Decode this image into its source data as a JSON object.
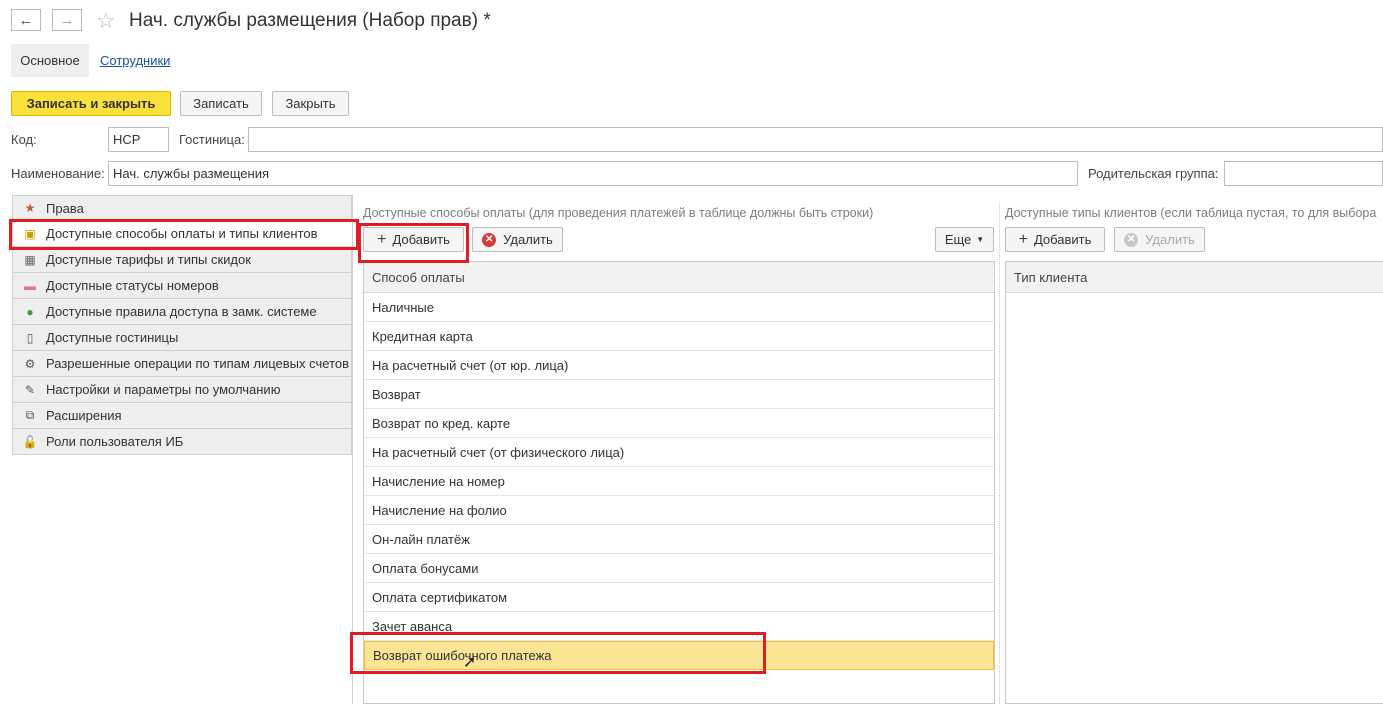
{
  "window": {
    "title": "Нач. службы размещения (Набор прав) *",
    "back_icon": "←",
    "forward_icon": "→",
    "star_icon": "☆"
  },
  "tabs": [
    {
      "label": "Основное"
    },
    {
      "label": "Сотрудники"
    }
  ],
  "toolbar": {
    "save_close": "Записать и закрыть",
    "save": "Записать",
    "close": "Закрыть"
  },
  "form": {
    "code_label": "Код:",
    "code_value": "НСР",
    "hotel_label": "Гостиница:",
    "hotel_value": "",
    "name_label": "Наименование:",
    "name_value": "Нач. службы размещения",
    "parent_label": "Родительская группа:",
    "parent_value": ""
  },
  "sidebar": {
    "items": [
      {
        "label": "Права",
        "icon": "★"
      },
      {
        "label": "Доступные способы оплаты и типы клиентов",
        "icon": "▣"
      },
      {
        "label": "Доступные тарифы и типы скидок",
        "icon": "▦"
      },
      {
        "label": "Доступные статусы номеров",
        "icon": "▬"
      },
      {
        "label": "Доступные правила доступа в замк. системе",
        "icon": "●"
      },
      {
        "label": "Доступные гостиницы",
        "icon": "▯"
      },
      {
        "label": "Разрешенные операции по типам лицевых счетов",
        "icon": "⚙"
      },
      {
        "label": "Настройки и параметры по умолчанию",
        "icon": "✎"
      },
      {
        "label": "Расширения",
        "icon": "⧉"
      },
      {
        "label": "Роли пользователя ИБ",
        "icon": "🔓"
      }
    ]
  },
  "payment_panel": {
    "caption": "Доступные способы оплаты (для проведения платежей в таблице должны быть строки)",
    "add_label": "Добавить",
    "delete_label": "Удалить",
    "more_label": "Еще",
    "column_header": "Способ оплаты",
    "rows": [
      "Наличные",
      "Кредитная карта",
      "На расчетный счет (от юр. лица)",
      "Возврат",
      "Возврат по кред. карте",
      "На расчетный счет (от физического лица)",
      "Начисление на номер",
      "Начисление на фолио",
      "Он-лайн платёж",
      "Оплата бонусами",
      "Оплата сертификатом",
      "Зачет аванса",
      "Возврат ошибочного платежа"
    ]
  },
  "client_panel": {
    "caption": "Доступные типы клиентов (если таблица пустая, то для выбора",
    "add_label": "Добавить",
    "delete_label": "Удалить",
    "column_header": "Тип клиента"
  },
  "colors": {
    "accent": "#fbe13a",
    "selection": "#fbe595",
    "highlight_box": "#e21b24",
    "link": "#1a52a5"
  }
}
